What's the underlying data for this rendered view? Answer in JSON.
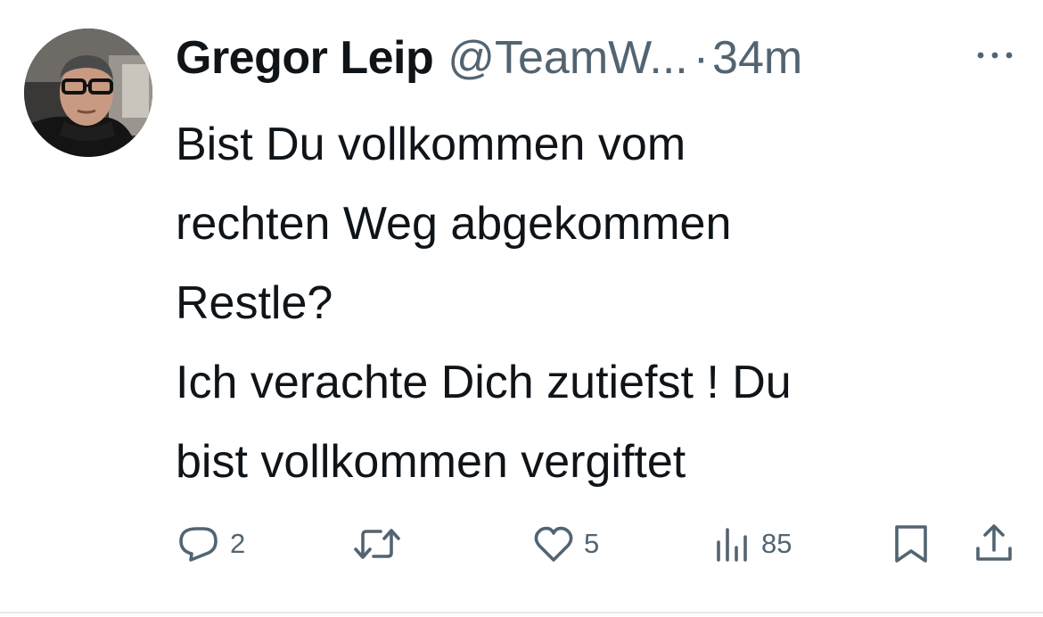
{
  "tweet": {
    "author": {
      "display_name": "Gregor Leip",
      "handle": "@TeamW...",
      "separator": "·",
      "time": "34m"
    },
    "text_lines": [
      "Bist Du vollkommen vom",
      "rechten Weg abgekommen",
      "Restle?",
      "Ich verachte Dich zutiefst ! Du",
      "bist vollkommen vergiftet"
    ],
    "actions": {
      "reply_count": "2",
      "retweet_count": "",
      "like_count": "5",
      "views_count": "85"
    }
  },
  "icons": {
    "more": "more-horizontal-icon",
    "reply": "reply-icon",
    "retweet": "retweet-icon",
    "like": "heart-icon",
    "views": "views-chart-icon",
    "bookmark": "bookmark-icon",
    "share": "share-icon"
  },
  "colors": {
    "text_primary": "#0f1419",
    "text_secondary": "#536471",
    "divider": "#e6e8ea",
    "background": "#ffffff"
  }
}
